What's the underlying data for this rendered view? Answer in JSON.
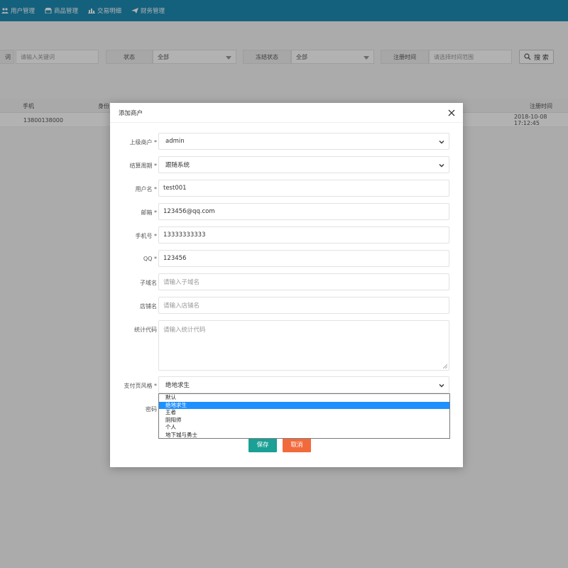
{
  "nav": {
    "items": [
      {
        "label": "用户管理",
        "icon": "users-icon"
      },
      {
        "label": "商品管理",
        "icon": "shop-icon"
      },
      {
        "label": "交易明细",
        "icon": "bar-chart-icon"
      },
      {
        "label": "财务管理",
        "icon": "send-icon"
      }
    ]
  },
  "filters": {
    "keyword_label_partial": "词",
    "keyword_placeholder": "请输入关键词",
    "status_label": "状态",
    "status_value": "全部",
    "freeze_label": "冻结状态",
    "freeze_value": "全部",
    "regtime_label": "注册时间",
    "regtime_placeholder": "请选择时间范围",
    "search_label": "搜 索"
  },
  "table": {
    "headers": {
      "phone": "手机",
      "identity_partial": "身份",
      "regtime": "注册时间"
    },
    "rows": [
      {
        "phone": "13800138000",
        "regtime": "2018-10-08 17:12:45"
      }
    ]
  },
  "modal": {
    "title": "添加商户",
    "fields": {
      "parent": {
        "label": "上级商户 *",
        "value": "admin"
      },
      "cycle": {
        "label": "结算周期 *",
        "value": "跟随系统"
      },
      "username": {
        "label": "用户名 *",
        "value": "test001"
      },
      "email": {
        "label": "邮箱 *",
        "value": "123456@qq.com"
      },
      "phone": {
        "label": "手机号 *",
        "value": "13333333333"
      },
      "qq": {
        "label": "QQ *",
        "value": "123456"
      },
      "subdomain": {
        "label": "子域名",
        "placeholder": "请输入子域名"
      },
      "shopname": {
        "label": "店铺名",
        "placeholder": "请输入店铺名"
      },
      "statcode": {
        "label": "统计代码",
        "placeholder": "请输入统计代码"
      },
      "paystyle": {
        "label": "支付页风格 *",
        "value": "绝地求生"
      },
      "password": {
        "label": "密码"
      }
    },
    "paystyle_options": [
      "默认",
      "绝地求生",
      "王者",
      "阴阳师",
      "个人",
      "地下城与勇士"
    ],
    "paystyle_selected_index": 1,
    "save_label": "保存",
    "cancel_label": "取消"
  },
  "colors": {
    "nav_bg": "#1e8bb5",
    "save_btn": "#1aa094",
    "cancel_btn": "#f26a3c",
    "selected_option": "#1e90ff"
  }
}
